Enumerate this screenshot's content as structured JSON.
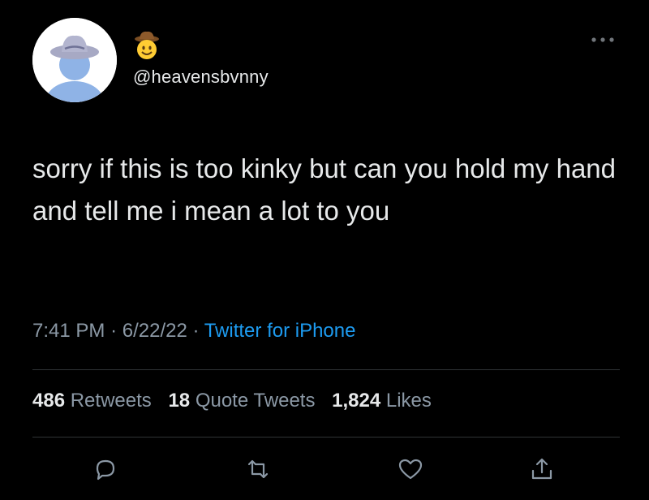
{
  "user": {
    "handle": "@heavensbvnny",
    "avatar": "blue-figure-cowboy-hat-avatar",
    "name_icon": "cowboy-hat-face-emoji"
  },
  "tweet": {
    "text": "sorry if this is too kinky but can you hold my hand and tell me i mean a lot to you",
    "time": "7:41 PM",
    "date": "6/22/22",
    "separator": "·",
    "source": "Twitter for iPhone"
  },
  "stats": {
    "retweets_count": "486",
    "retweets_label": "Retweets",
    "quotes_count": "18",
    "quotes_label": "Quote Tweets",
    "likes_count": "1,824",
    "likes_label": "Likes"
  },
  "actions": [
    "reply-icon",
    "retweet-icon",
    "like-icon",
    "share-icon"
  ],
  "colors": {
    "background": "#000000",
    "text": "#e7e9ea",
    "secondary": "#8b98a5",
    "link": "#1d9bf0",
    "divider": "#2f3336"
  }
}
